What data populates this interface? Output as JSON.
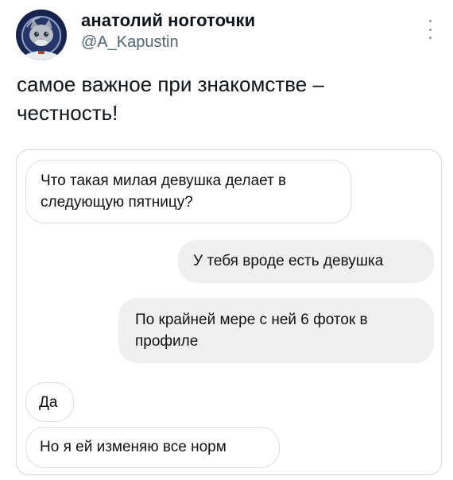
{
  "author": {
    "name": "анатолий ноготочки",
    "handle": "@A_Kapustin",
    "avatar_icon": "cat-astronaut-avatar"
  },
  "tweet": {
    "text": "самое важное при знакомстве –\nчестность!"
  },
  "chat": {
    "messages": [
      {
        "side": "incoming",
        "text": "Что такая милая девушка делает в\nследующую пятницу?"
      },
      {
        "side": "outgoing",
        "text": "У тебя вроде есть девушка"
      },
      {
        "side": "outgoing",
        "text": "По крайней мере с ней 6 фоток в\nпрофиле"
      },
      {
        "side": "incoming",
        "text": "Да"
      },
      {
        "side": "incoming",
        "text": "Но я ей изменяю все норм"
      }
    ]
  },
  "icons": {
    "more": "more-vertical-icon"
  },
  "colors": {
    "text": "#0f1419",
    "handle": "#536471",
    "incoming_bubble": "#ffffff",
    "outgoing_bubble": "#efefef",
    "media_border": "#cfd9de"
  }
}
